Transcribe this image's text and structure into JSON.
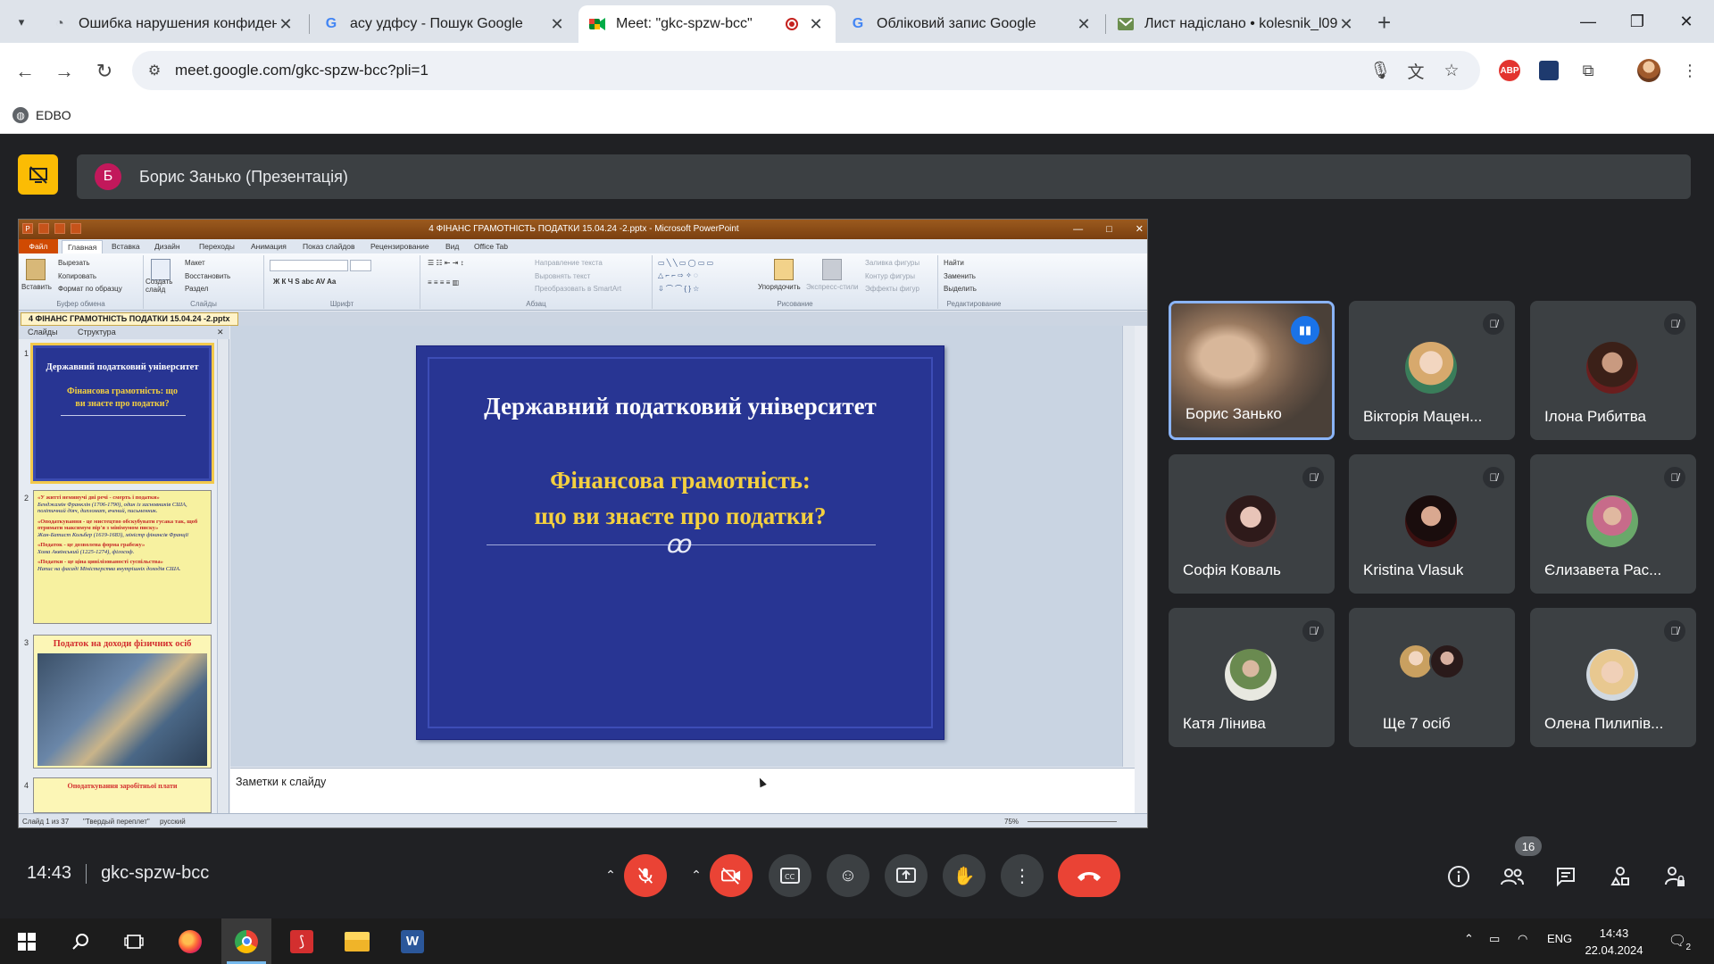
{
  "browser": {
    "tabs": [
      {
        "title": "Ошибка нарушения конфиденци",
        "favicon": "chrome-icon"
      },
      {
        "title": "асу удфсу - Пошук Google",
        "favicon": "google-icon"
      },
      {
        "title": "Meet: \"gkc-spzw-bcc\"",
        "favicon": "meet-icon",
        "active": true
      },
      {
        "title": "Обліковий запис Google",
        "favicon": "google-icon"
      },
      {
        "title": "Лист надіслано • kolesnik_l09",
        "favicon": "gmail-icon"
      }
    ],
    "url": "meet.google.com/gkc-spzw-bcc?pli=1",
    "bookmark": "EDBO",
    "abp_label": "ABP"
  },
  "meet": {
    "presenter_initial": "Б",
    "presenter_label": "Борис Занько (Презентація)",
    "time": "14:43",
    "meeting_code": "gkc-spzw-bcc",
    "people_count": "16",
    "participants": [
      {
        "name": "Борис Занько",
        "muted": false,
        "speaking": true,
        "video": true
      },
      {
        "name": "Вікторія Мацен...",
        "muted": true
      },
      {
        "name": "Ілона Рибитва",
        "muted": true
      },
      {
        "name": "Софія Коваль",
        "muted": true
      },
      {
        "name": "Kristina Vlasuk",
        "muted": true
      },
      {
        "name": "Єлизавета Рас...",
        "muted": true
      },
      {
        "name": "Катя Лінива",
        "muted": true
      },
      {
        "name": "Ще 7 осіб",
        "muted": false
      },
      {
        "name": "Олена Пилипів...",
        "muted": true
      }
    ]
  },
  "ppt": {
    "window_title": "4 ФІНАНС ГРАМОТНІСТЬ ПОДАТКИ 15.04.24 -2.pptx - Microsoft PowerPoint",
    "menu": [
      "Файл",
      "Главная",
      "Вставка",
      "Дизайн",
      "Переходы",
      "Анимация",
      "Показ слайдов",
      "Рецензирование",
      "Вид",
      "Office Tab"
    ],
    "ribbon": {
      "paste": "Вставить",
      "cut": "Вырезать",
      "copy": "Копировать",
      "format_painter": "Формат по образцу",
      "clipboard": "Буфер обмена",
      "new_slide": "Создать слайд",
      "layout": "Макет",
      "reset": "Восстановить",
      "section": "Раздел",
      "slides": "Слайды",
      "font": "Шрифт",
      "text_dir": "Направление текста",
      "align_text": "Выровнять текст",
      "smartart": "Преобразовать в SmartArt",
      "paragraph": "Абзац",
      "arrange": "Упорядочить",
      "quick_styles": "Экспресс-стили",
      "shape_fill": "Заливка фигуры",
      "shape_outline": "Контур фигуры",
      "shape_effects": "Эффекты фигур",
      "drawing": "Рисование",
      "find": "Найти",
      "replace": "Заменить",
      "select": "Выделить",
      "editing": "Редактирование"
    },
    "doc_tab": "4 ФІНАНС ГРАМОТНІСТЬ ПОДАТКИ 15.04.24 -2.pptx",
    "panel_tabs": [
      "Слайды",
      "Структура"
    ],
    "thumb_nums": [
      "1",
      "2",
      "3",
      "4"
    ],
    "thumb1": {
      "title": "Державний податковий університет",
      "sub": "Фінансова грамотність: що ви знаєте про податки?"
    },
    "thumb2": {
      "l1": "«У житті неминучі дві речі - смерть і податки»",
      "l2": "Бенджамін Франклін (1706-1790), один із засновників США, політичний діяч, дипломат, вчений, письменник.",
      "l3": "«Оподаткування - це мистецтво обскубувати гусака так, щоб отримати максимум пір'я з мінімумом писку»",
      "l4": "Жан-Батист Кольбер (1619-1683), міністр фінансів Франції",
      "l5": "«Податок - це дозволена форма грабежу»",
      "l6": "Хома Аквінський (1225-1274), філософ.",
      "l7": "«Податки - це ціна цивілізованості суспільства»",
      "l8": "Напис на фасаді Міністерства внутрішніх доходів США."
    },
    "thumb3": {
      "title": "Податок на доходи фізичних осіб"
    },
    "thumb4": {
      "title": "Оподаткування заробітньої плати"
    },
    "slide": {
      "title": "Державний податковий університет",
      "subtitle_1": "Фінансова грамотність:",
      "subtitle_2": "що ви знаєте про податки?"
    },
    "notes": "Заметки к слайду",
    "status": {
      "slide": "Слайд 1 из 37",
      "theme": "\"Твердый переплет\"",
      "lang": "русский",
      "zoom": "75%"
    }
  },
  "taskbar": {
    "lang": "ENG",
    "time": "14:43",
    "date": "22.04.2024",
    "notif_count": "2"
  }
}
